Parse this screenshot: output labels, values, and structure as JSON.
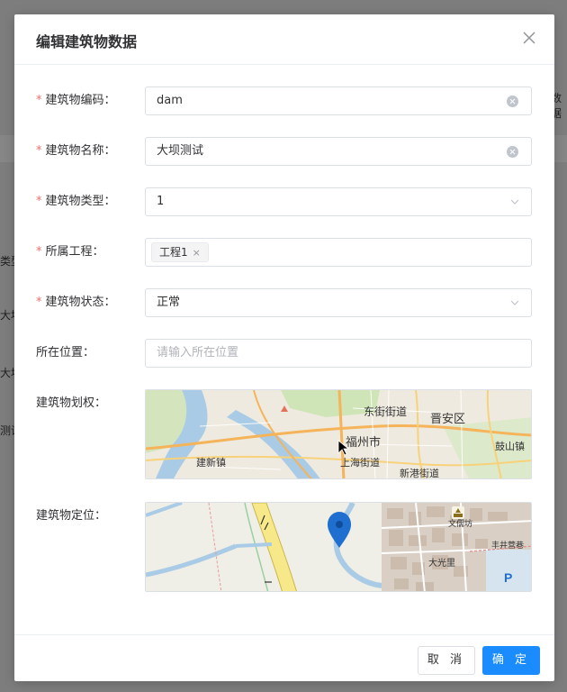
{
  "background": {
    "fragments": [
      "类型",
      "大坝",
      "大坝",
      "测试",
      "数据"
    ]
  },
  "dialog": {
    "title": "编辑建筑物数据",
    "close_icon": "close-icon"
  },
  "form": {
    "code": {
      "label": "建筑物编码：",
      "value": "dam",
      "required": true
    },
    "name": {
      "label": "建筑物名称：",
      "value": "大坝测试",
      "required": true
    },
    "type": {
      "label": "建筑物类型：",
      "value": "1",
      "required": true
    },
    "project": {
      "label": "所属工程：",
      "tag": "工程1",
      "tag_close": "×",
      "required": true
    },
    "status": {
      "label": "建筑物状态：",
      "value": "正常",
      "required": true
    },
    "location": {
      "label": "所在位置：",
      "placeholder": "请输入所在位置"
    },
    "boundary": {
      "label": "建筑物划权："
    },
    "position": {
      "label": "建筑物定位："
    }
  },
  "map1": {
    "labels": [
      "东街街道",
      "晋安区",
      "福州市",
      "鼓山镇",
      "建新镇",
      "上海街道",
      "新港街道"
    ]
  },
  "map2": {
    "labels": [
      "大光里",
      "文儒坊",
      "丰井营巷",
      "P"
    ]
  },
  "footer": {
    "cancel_label": "取 消",
    "ok_label": "确 定"
  },
  "colors": {
    "primary": "#1a8cff",
    "required": "#f56c6c",
    "marker": "#1e6fd0"
  }
}
